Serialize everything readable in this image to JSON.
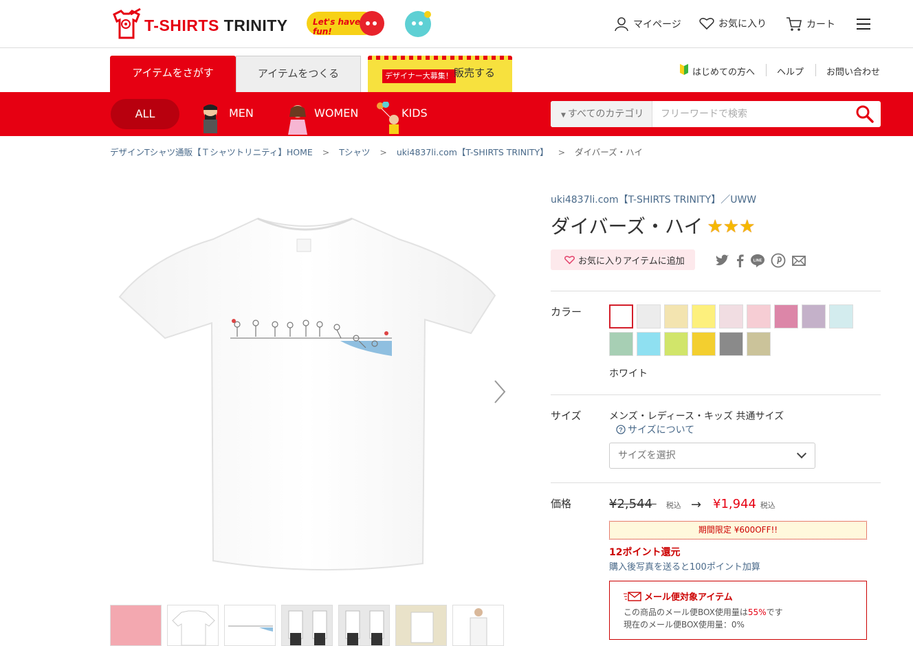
{
  "header": {
    "logo_prefix": "T-SHIRTS",
    "logo_suffix": " TRINITY",
    "fun_badge": "Let's have fun!",
    "mypage": "マイページ",
    "favorites": "お気に入り",
    "cart": "カート"
  },
  "tabs": {
    "search_items": "アイテムをさがす",
    "make_items": "アイテムをつくる",
    "designer_tag": "デザイナー大募集！",
    "sell": "販売する"
  },
  "util_links": {
    "beginners": "はじめての方へ",
    "help": "ヘルプ",
    "contact": "お問い合わせ"
  },
  "categories": {
    "all": "ALL",
    "men": "MEN",
    "women": "WOMEN",
    "kids": "KIDS"
  },
  "search": {
    "category_label": "すべてのカテゴリ",
    "placeholder": "フリーワードで検索"
  },
  "breadcrumb": [
    "デザインTシャツ通販【Ｔシャツトリニティ】HOME",
    "Tシャツ",
    "uki4837li.com【T-SHIRTS TRINITY】",
    "ダイバーズ・ハイ"
  ],
  "breadcrumb_sep": ">",
  "product": {
    "shop": "uki4837li.com【T-SHIRTS TRINITY】／UWW",
    "title": "ダイバーズ・ハイ",
    "stars": 3,
    "fav_button": "お気に入りアイテムに追加",
    "color_label": "カラー",
    "selected_color": "ホワイト",
    "size_label": "サイズ",
    "size_text": "メンズ・レディース・キッズ 共通サイズ",
    "size_help": "サイズについて",
    "size_select_placeholder": "サイズを選択",
    "price_label": "価格",
    "price_old": "¥2,544",
    "price_new": "¥1,944",
    "tax_label": "税込",
    "promo": "期間限定 ¥600OFF!!",
    "points": "12ポイント還元",
    "points_note": "購入後写真を送ると100ポイント加算",
    "mail_title": "メール便対象アイテム",
    "mail_line1_prefix": "この商品のメール便BOX使用量は",
    "mail_line1_value": "55%",
    "mail_line1_suffix": "です",
    "mail_line2": "現在のメール便BOX使用量：0%"
  },
  "swatch_colors": [
    "#ffffff",
    "#ececec",
    "#f3e4b0",
    "#fdf07d",
    "#f1dde2",
    "#f6cdd4",
    "#dc86a8",
    "#c4b1c9",
    "#d3ecee",
    "#a7cfb4",
    "#8fe0f1",
    "#d1e56a",
    "#f3cf2f",
    "#8a8a8a",
    "#cbc39a"
  ],
  "icons": [
    "user-icon",
    "heart-icon",
    "cart-icon",
    "menu-icon",
    "search-icon",
    "twitter-icon",
    "facebook-icon",
    "line-icon",
    "pinterest-icon",
    "mail-icon",
    "chevron-right-icon",
    "chevron-down-icon",
    "help-icon",
    "beginner-icon"
  ],
  "accent_color": "#e60012"
}
